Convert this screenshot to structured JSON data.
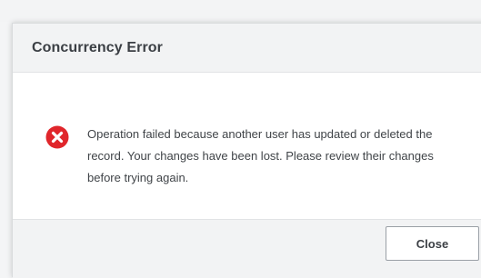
{
  "dialog": {
    "title": "Concurrency Error",
    "icon": "error-circle-x-icon",
    "message": "Operation failed because another user has updated or deleted the record. Your changes have been lost. Please review their changes before trying again.",
    "close_label": "Close"
  },
  "colors": {
    "error_red": "#e0262b",
    "title_text": "#3b3f44",
    "header_bg": "#f2f3f4"
  }
}
